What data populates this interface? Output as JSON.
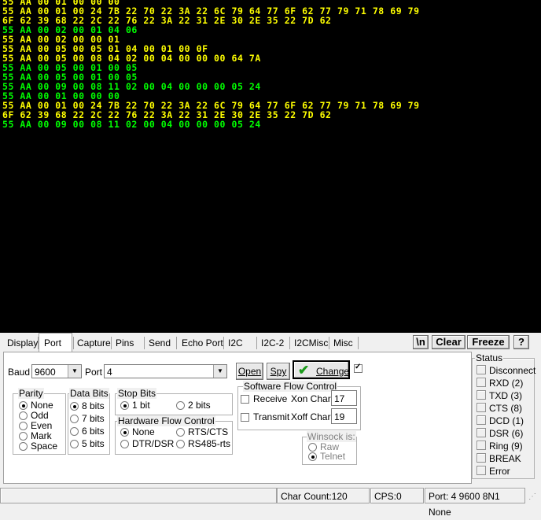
{
  "terminal": {
    "lines": [
      {
        "text": "55 AA 00 01 00 00 00",
        "color": "yellow"
      },
      {
        "text": "55 AA 00 01 00 24 7B 22 70 22 3A 22 6C 79 64 77 6F 62 77 79 71 78 69 79",
        "color": "yellow"
      },
      {
        "text": "6F 62 39 68 22 2C 22 76 22 3A 22 31 2E 30 2E 35 22 7D 62",
        "color": "yellow"
      },
      {
        "text": "55 AA 00 02 00 01 04 06",
        "color": "green"
      },
      {
        "text": "55 AA 00 02 00 00 01",
        "color": "yellow"
      },
      {
        "text": "55 AA 00 05 00 05 01 04 00 01 00 0F",
        "color": "yellow"
      },
      {
        "text": "55 AA 00 05 00 08 04 02 00 04 00 00 00 64 7A",
        "color": "yellow"
      },
      {
        "text": "55 AA 00 05 00 01 00 05",
        "color": "green"
      },
      {
        "text": "55 AA 00 05 00 01 00 05",
        "color": "green"
      },
      {
        "text": "55 AA 00 09 00 08 11 02 00 04 00 00 00 05 24",
        "color": "green"
      },
      {
        "text": "55 AA 00 01 00 00 00",
        "color": "green"
      },
      {
        "text": "55 AA 00 01 00 24 7B 22 70 22 3A 22 6C 79 64 77 6F 62 77 79 71 78 69 79",
        "color": "yellow"
      },
      {
        "text": "6F 62 39 68 22 2C 22 76 22 3A 22 31 2E 30 2E 35 22 7D 62",
        "color": "yellow"
      },
      {
        "text": "55 AA 00 09 00 08 11 02 00 04 00 00 00 05 24",
        "color": "green"
      }
    ]
  },
  "tabs": [
    "Display",
    "Port",
    "Capture",
    "Pins",
    "Send",
    "Echo Port",
    "I2C",
    "I2C-2",
    "I2CMisc",
    "Misc"
  ],
  "active_tab": "Port",
  "toolbar": {
    "newline": "\\n",
    "clear": "Clear",
    "freeze": "Freeze",
    "help": "?"
  },
  "port": {
    "baud_label": "Baud",
    "baud_value": "9600",
    "port_label": "Port",
    "port_value": "4",
    "open_label": "Open",
    "spy_label": "Spy",
    "change_label": "Change",
    "parity": {
      "title": "Parity",
      "options": [
        "None",
        "Odd",
        "Even",
        "Mark",
        "Space"
      ],
      "selected": "None"
    },
    "databits": {
      "title": "Data Bits",
      "options": [
        "8 bits",
        "7 bits",
        "6 bits",
        "5 bits"
      ],
      "selected": "8 bits"
    },
    "stopbits": {
      "title": "Stop Bits",
      "options": [
        "1 bit",
        "2 bits"
      ],
      "selected": "1 bit"
    },
    "hwflow": {
      "title": "Hardware Flow Control",
      "options": [
        "None",
        "RTS/CTS",
        "DTR/DSR",
        "RS485-rts"
      ],
      "selected": "None"
    },
    "swflow": {
      "title": "Software Flow Control",
      "receive": "Receive",
      "transmit": "Transmit",
      "xon_label": "Xon Char:",
      "xon_value": "17",
      "xoff_label": "Xoff Char:",
      "xoff_value": "19"
    },
    "winsock": {
      "title": "Winsock is:",
      "options": [
        "Raw",
        "Telnet"
      ],
      "selected": "Telnet"
    }
  },
  "status": {
    "title": "Status",
    "items": [
      "Disconnect",
      "RXD (2)",
      "TXD (3)",
      "CTS (8)",
      "DCD (1)",
      "DSR (6)",
      "Ring (9)",
      "BREAK",
      "Error"
    ]
  },
  "statusbar": {
    "char_count": "Char Count:120",
    "cps": "CPS:0",
    "port_info": "Port: 4 9600 8N1 None"
  },
  "colors": {
    "yellow": "#ffff00",
    "green": "#00ff00",
    "terminal_bg": "#000000"
  }
}
